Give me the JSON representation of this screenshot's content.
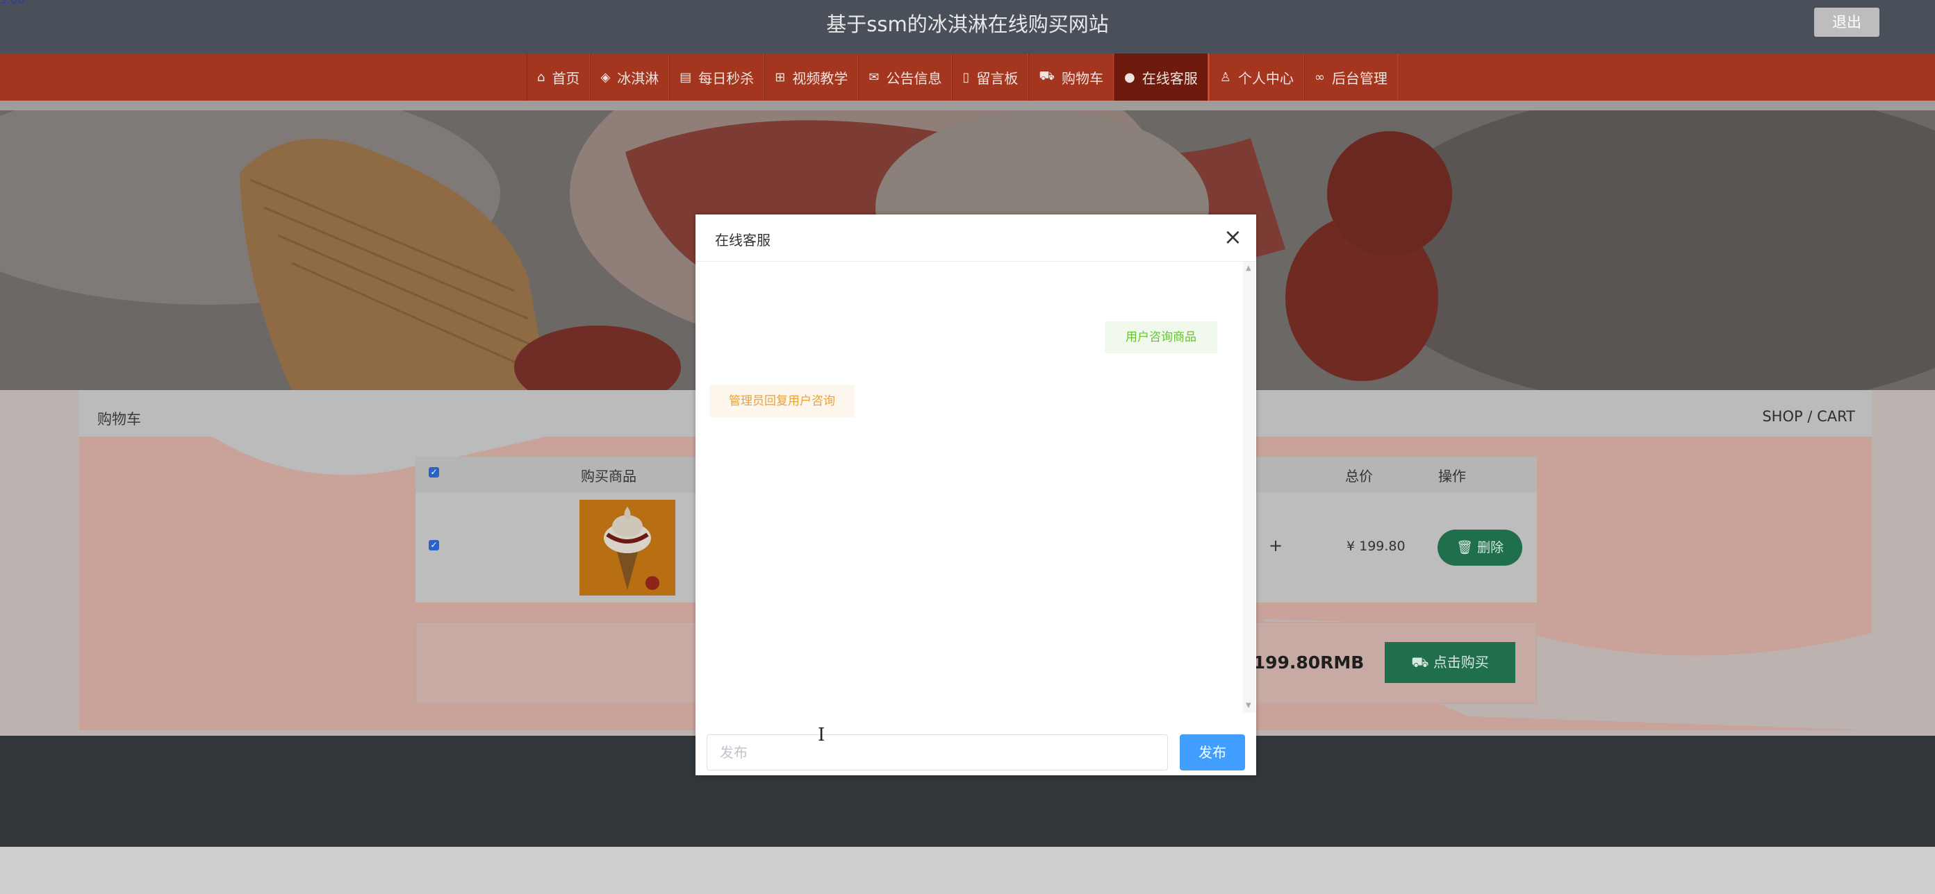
{
  "header": {
    "site_title": "基于ssm的冰淇淋在线购买网站",
    "logout_label": "退出",
    "corner_text": "5.00"
  },
  "nav": {
    "items": [
      {
        "label": "首页",
        "icon": "home-icon"
      },
      {
        "label": "冰淇淋",
        "icon": "layers-icon"
      },
      {
        "label": "每日秒杀",
        "icon": "calendar-icon"
      },
      {
        "label": "视频教学",
        "icon": "video-icon"
      },
      {
        "label": "公告信息",
        "icon": "mail-icon"
      },
      {
        "label": "留言板",
        "icon": "note-icon"
      },
      {
        "label": "购物车",
        "icon": "cart-icon"
      },
      {
        "label": "在线客服",
        "icon": "chat-icon",
        "active": true
      },
      {
        "label": "个人中心",
        "icon": "user-icon"
      },
      {
        "label": "后台管理",
        "icon": "link-icon"
      }
    ]
  },
  "panel": {
    "title": "购物车",
    "crumb": "SHOP / CART"
  },
  "cart": {
    "columns": {
      "product": "购买商品",
      "total": "总价",
      "action": "操作"
    },
    "rows": [
      {
        "plus": "+",
        "price": "¥ 199.80",
        "delete_label": "删除"
      }
    ],
    "total_text": "：  199.80RMB",
    "buy_label": "点击购买"
  },
  "chat": {
    "title": "在线客服",
    "messages": {
      "user": "用户咨询商品",
      "admin": "管理员回复用户咨询"
    },
    "input_placeholder": "发布",
    "send_label": "发布"
  },
  "colors": {
    "nav_bg": "#a4351f",
    "nav_active": "#6e1b0d",
    "topbar": "#4a505a",
    "button_green": "#1f6e4c",
    "send_blue": "#409eff"
  }
}
